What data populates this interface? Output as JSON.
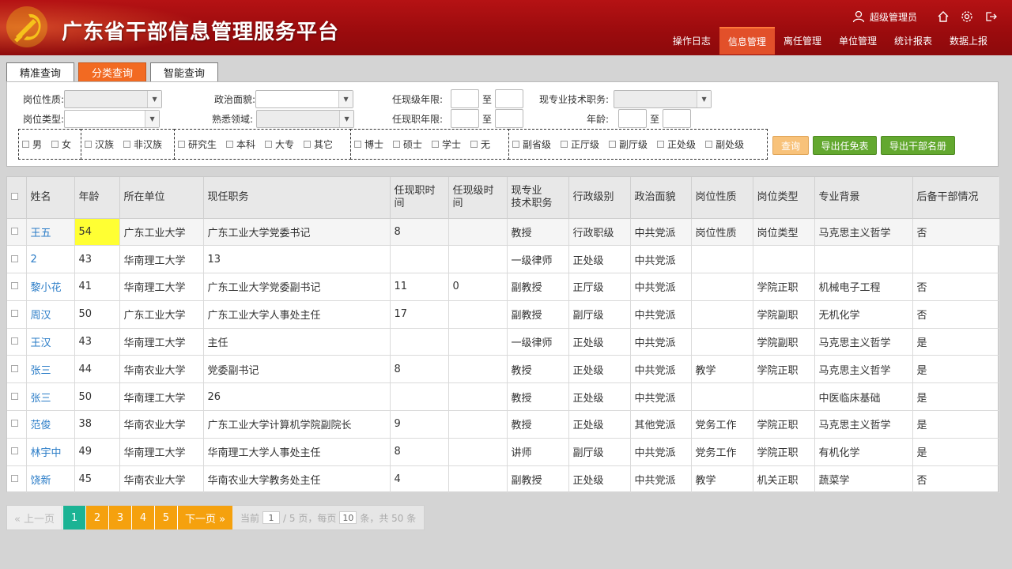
{
  "header": {
    "title": "广东省干部信息管理服务平台",
    "user": "超级管理员",
    "nav": [
      {
        "label": "操作日志",
        "active": false
      },
      {
        "label": "信息管理",
        "active": true
      },
      {
        "label": "离任管理",
        "active": false
      },
      {
        "label": "单位管理",
        "active": false
      },
      {
        "label": "统计报表",
        "active": false
      },
      {
        "label": "数据上报",
        "active": false
      }
    ],
    "colors": {
      "accent": "#e2502a",
      "header_bg": "#9a0b0d"
    }
  },
  "tabs": [
    {
      "label": "精准查询",
      "active": false
    },
    {
      "label": "分类查询",
      "active": true
    },
    {
      "label": "智能查询",
      "active": false
    }
  ],
  "filters": {
    "post_nature": "岗位性质:",
    "political": "政治面貌:",
    "cur_level_years": "任现级年限:",
    "tech_title": "现专业技术职务:",
    "post_type": "岗位类型:",
    "familiar_field": "熟悉领域:",
    "cur_post_years": "任现职年限:",
    "age": "年龄:",
    "to": "至"
  },
  "checkbox_groups": [
    [
      "男",
      "女"
    ],
    [
      "汉族",
      "非汉族"
    ],
    [
      "研究生",
      "本科",
      "大专",
      "其它"
    ],
    [
      "博士",
      "硕士",
      "学士",
      "无"
    ],
    [
      "副省级",
      "正厅级",
      "副厅级",
      "正处级",
      "副处级"
    ]
  ],
  "buttons": {
    "query": "查询",
    "export_appoint": "导出任免表",
    "export_roster": "导出干部名册"
  },
  "table": {
    "headers": [
      "姓名",
      "年龄",
      "所在单位",
      "现任职务",
      "任现职时间",
      "任现级时间",
      "现专业\n技术职务",
      "行政级别",
      "政治面貌",
      "岗位性质",
      "岗位类型",
      "专业背景",
      "后备干部情况"
    ],
    "rows": [
      [
        "王五",
        "54",
        "广东工业大学",
        "广东工业大学党委书记",
        "8",
        "",
        "教授",
        "行政职级",
        "中共党派",
        "岗位性质",
        "岗位类型",
        "马克思主义哲学",
        "否"
      ],
      [
        "2",
        "43",
        "华南理工大学",
        "13",
        "",
        "",
        "一级律师",
        "正处级",
        "中共党派",
        "",
        "",
        "",
        ""
      ],
      [
        "黎小花",
        "41",
        "华南理工大学",
        "广东工业大学党委副书记",
        "11",
        "0",
        "副教授",
        "正厅级",
        "中共党派",
        "",
        "学院正职",
        "机械电子工程",
        "否"
      ],
      [
        "周汉",
        "50",
        "广东工业大学",
        "广东工业大学人事处主任",
        "17",
        "",
        "副教授",
        "副厅级",
        "中共党派",
        "",
        "学院副职",
        "无机化学",
        "否"
      ],
      [
        "王汉",
        "43",
        "华南理工大学",
        "主任",
        "",
        "",
        "一级律师",
        "正处级",
        "中共党派",
        "",
        "学院副职",
        "马克思主义哲学",
        "是"
      ],
      [
        "张三",
        "44",
        "华南农业大学",
        "党委副书记",
        "8",
        "",
        "教授",
        "正处级",
        "中共党派",
        "教学",
        "学院正职",
        "马克思主义哲学",
        "是"
      ],
      [
        "张三",
        "50",
        "华南理工大学",
        "26",
        "",
        "",
        "教授",
        "正处级",
        "中共党派",
        "",
        "",
        "中医临床基础",
        "是"
      ],
      [
        "范俊",
        "38",
        "华南农业大学",
        "广东工业大学计算机学院副院长",
        "9",
        "",
        "教授",
        "正处级",
        "其他党派",
        "党务工作",
        "学院正职",
        "马克思主义哲学",
        "是"
      ],
      [
        "林宇中",
        "49",
        "华南理工大学",
        "华南理工大学人事处主任",
        "8",
        "",
        "讲师",
        "副厅级",
        "中共党派",
        "党务工作",
        "学院正职",
        "有机化学",
        "是"
      ],
      [
        "饶新",
        "45",
        "华南农业大学",
        "华南农业大学教务处主任",
        "4",
        "",
        "副教授",
        "正处级",
        "中共党派",
        "教学",
        "机关正职",
        "蔬菜学",
        "否"
      ]
    ]
  },
  "pager": {
    "prev": "« 上一页",
    "next": "下一页 »",
    "pages": [
      "1",
      "2",
      "3",
      "4",
      "5"
    ],
    "current": "1",
    "current_label": "当前",
    "total_pages_label": "/ 5 页，每页",
    "per_page": "10",
    "total_label": "条，共 50 条"
  }
}
